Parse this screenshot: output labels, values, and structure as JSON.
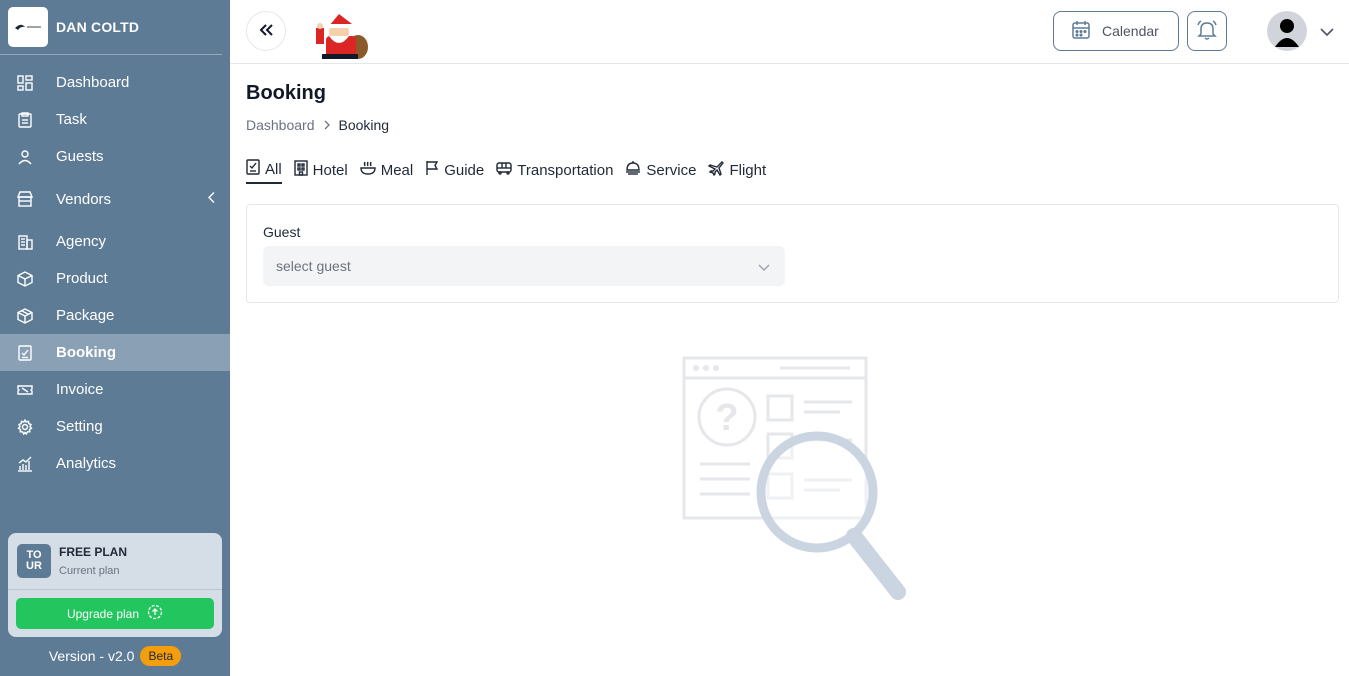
{
  "brand": {
    "name": "DAN COLTD",
    "logo_icon": "company-logo"
  },
  "sidebar": {
    "items": [
      {
        "label": "Dashboard",
        "icon": "dashboard-icon"
      },
      {
        "label": "Task",
        "icon": "clipboard-icon"
      },
      {
        "label": "Guests",
        "icon": "user-icon"
      },
      {
        "label": "Vendors",
        "icon": "store-icon"
      },
      {
        "label": "Agency",
        "icon": "building-icon"
      },
      {
        "label": "Product",
        "icon": "box-icon"
      },
      {
        "label": "Package",
        "icon": "package-icon"
      },
      {
        "label": "Booking",
        "icon": "checklist-icon",
        "active": true
      },
      {
        "label": "Invoice",
        "icon": "ticket-icon"
      },
      {
        "label": "Setting",
        "icon": "gear-icon"
      },
      {
        "label": "Analytics",
        "icon": "chart-icon"
      }
    ]
  },
  "plan": {
    "logo_text": "TO UR",
    "title": "FREE PLAN",
    "subtitle": "Current plan",
    "upgrade_label": "Upgrade plan"
  },
  "version": {
    "text": "Version - v2.0",
    "badge": "Beta"
  },
  "header": {
    "calendar_label": "Calendar"
  },
  "page": {
    "title": "Booking",
    "breadcrumb": {
      "parent": "Dashboard",
      "current": "Booking"
    }
  },
  "tabs": [
    {
      "label": "All",
      "icon": "checklist-icon",
      "active": true
    },
    {
      "label": "Hotel",
      "icon": "hotel-icon"
    },
    {
      "label": "Meal",
      "icon": "meal-icon"
    },
    {
      "label": "Guide",
      "icon": "flag-icon"
    },
    {
      "label": "Transportation",
      "icon": "bus-icon"
    },
    {
      "label": "Service",
      "icon": "service-icon"
    },
    {
      "label": "Flight",
      "icon": "plane-icon"
    }
  ],
  "filter": {
    "label": "Guest",
    "placeholder": "select guest"
  },
  "colors": {
    "sidebar": "#5e7b96",
    "active_item": "#8aa0b4",
    "upgrade": "#22c55e",
    "beta": "#f59e0b"
  }
}
